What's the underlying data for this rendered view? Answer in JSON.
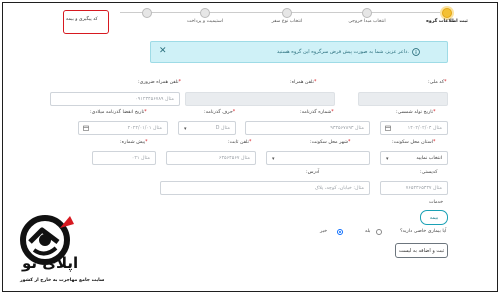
{
  "stepper": {
    "steps": [
      {
        "label": "ثبت اطلاعات گروه"
      },
      {
        "label": "انتخاب مبدا خروجی"
      },
      {
        "label": "انتخاب نوع سفر"
      },
      {
        "label": "استیمیت و پرداخت"
      },
      {
        "label": "کد پیگیری و بیمه"
      }
    ],
    "active_color": "#f3c033"
  },
  "alert": {
    "message": "داعر عزیز، شما به صورت پیش فرض سرگروه این گروه هستید."
  },
  "form": {
    "national_code": {
      "label": "کد ملی:",
      "value": ""
    },
    "phone": {
      "label": "تلفن همراه:",
      "value": ""
    },
    "emergency_phone": {
      "label": "تلفن همراه ضروری:",
      "placeholder": "مثال ۰۹۱۲۳۴۵۶۷۸۹"
    },
    "birth_date": {
      "label": "تاریخ تولد شمسی:",
      "placeholder": "مثال ۱۴۰۲/۰۲/۰۴"
    },
    "passport_number": {
      "label": "شماره گذرنامه:",
      "placeholder": "مثال ۹۳۴۵۶۷۸۹۳"
    },
    "passport_letter": {
      "label": "حرف گذرنامه:",
      "placeholder": "مثال D"
    },
    "passport_expiry": {
      "label": "تاریخ انقضا گذرنامه میلادی:",
      "placeholder": "مثال ۲۰۲۴/۰۱/۰۱"
    },
    "province": {
      "label": "استان محل سکونت:",
      "value": "انتخاب نمایید"
    },
    "city": {
      "label": "شهر محل سکونت:",
      "value": ""
    },
    "landline": {
      "label": "تلفن ثابت:",
      "placeholder": "مثال ۶۴۵۶۴۵۶۷"
    },
    "area_code": {
      "label": "پیش شماره:",
      "placeholder": "مثال ۰۲۱"
    },
    "postal_code": {
      "label": "کدپستی:",
      "placeholder": "مثال ۷۶۵۴۳۶۵۴۳۷"
    },
    "address": {
      "label": "آدرس:",
      "placeholder": "مثال: خیابان، کوچه، پلاک"
    },
    "services_label": "خدمات",
    "insurance_button": "بیمه",
    "disease_question": "آیا بیماری خاصی دارید؟",
    "yes_label": "بله",
    "no_label": "خیر",
    "submit_button": "ثبت و اضافه به لیست"
  },
  "watermark": {
    "brand": "اپلای تو",
    "tagline": "سایت جامع مهاجرت به خارج از کشور",
    "icon": "globe-badge-logo"
  }
}
